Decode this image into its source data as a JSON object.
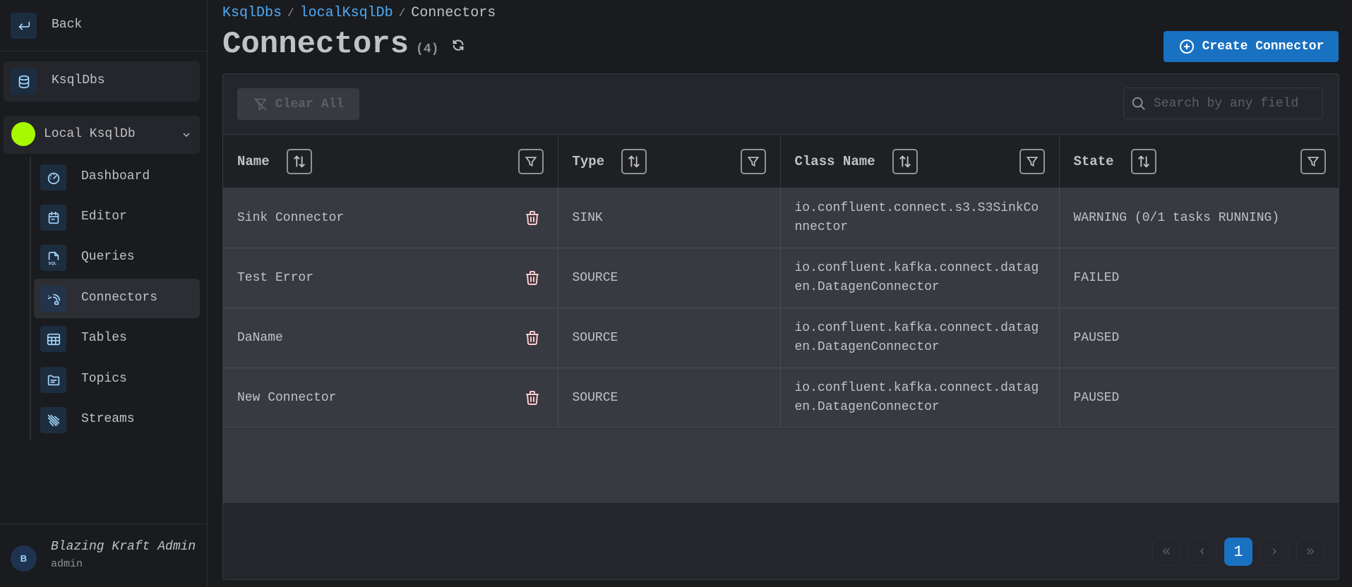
{
  "sidebar": {
    "back_label": "Back",
    "ksqldbs_label": "KsqlDbs",
    "current_db": {
      "label": "Local KsqlDb",
      "color": "#a6f900"
    },
    "items": [
      {
        "label": "Dashboard",
        "icon": "dashboard-gauge-icon"
      },
      {
        "label": "Editor",
        "icon": "calendar-editor-icon"
      },
      {
        "label": "Queries",
        "icon": "sql-file-icon"
      },
      {
        "label": "Connectors",
        "icon": "connectors-icon",
        "active": true
      },
      {
        "label": "Tables",
        "icon": "table-icon"
      },
      {
        "label": "Topics",
        "icon": "folder-icon"
      },
      {
        "label": "Streams",
        "icon": "streams-icon"
      }
    ],
    "user": {
      "initial": "B",
      "name": "Blazing Kraft Admin",
      "role": "admin"
    }
  },
  "breadcrumb": [
    {
      "label": "KsqlDbs"
    },
    {
      "label": "localKsqlDb"
    },
    {
      "label": "Connectors"
    }
  ],
  "header": {
    "title": "Connectors",
    "count": "(4)",
    "create_label": "Create Connector"
  },
  "toolbar": {
    "clear_label": "Clear All",
    "search_placeholder": "Search by any field"
  },
  "table": {
    "columns": [
      "Name",
      "Type",
      "Class Name",
      "State"
    ],
    "rows": [
      {
        "name": "Sink Connector",
        "type": "SINK",
        "class_name": "io.confluent.connect.s3.S3SinkConnector",
        "state": "WARNING (0/1 tasks RUNNING)"
      },
      {
        "name": "Test Error",
        "type": "SOURCE",
        "class_name": "io.confluent.kafka.connect.datagen.DatagenConnector",
        "state": "FAILED"
      },
      {
        "name": "DaName",
        "type": "SOURCE",
        "class_name": "io.confluent.kafka.connect.datagen.DatagenConnector",
        "state": "PAUSED"
      },
      {
        "name": "New Connector",
        "type": "SOURCE",
        "class_name": "io.confluent.kafka.connect.datagen.DatagenConnector",
        "state": "PAUSED"
      }
    ]
  },
  "pagination": {
    "first": "«",
    "prev": "‹",
    "current": "1",
    "next": "›",
    "last": "»"
  },
  "colors": {
    "accent": "#1971c2",
    "link": "#4dabf7",
    "delete": "#ffc9c9"
  }
}
